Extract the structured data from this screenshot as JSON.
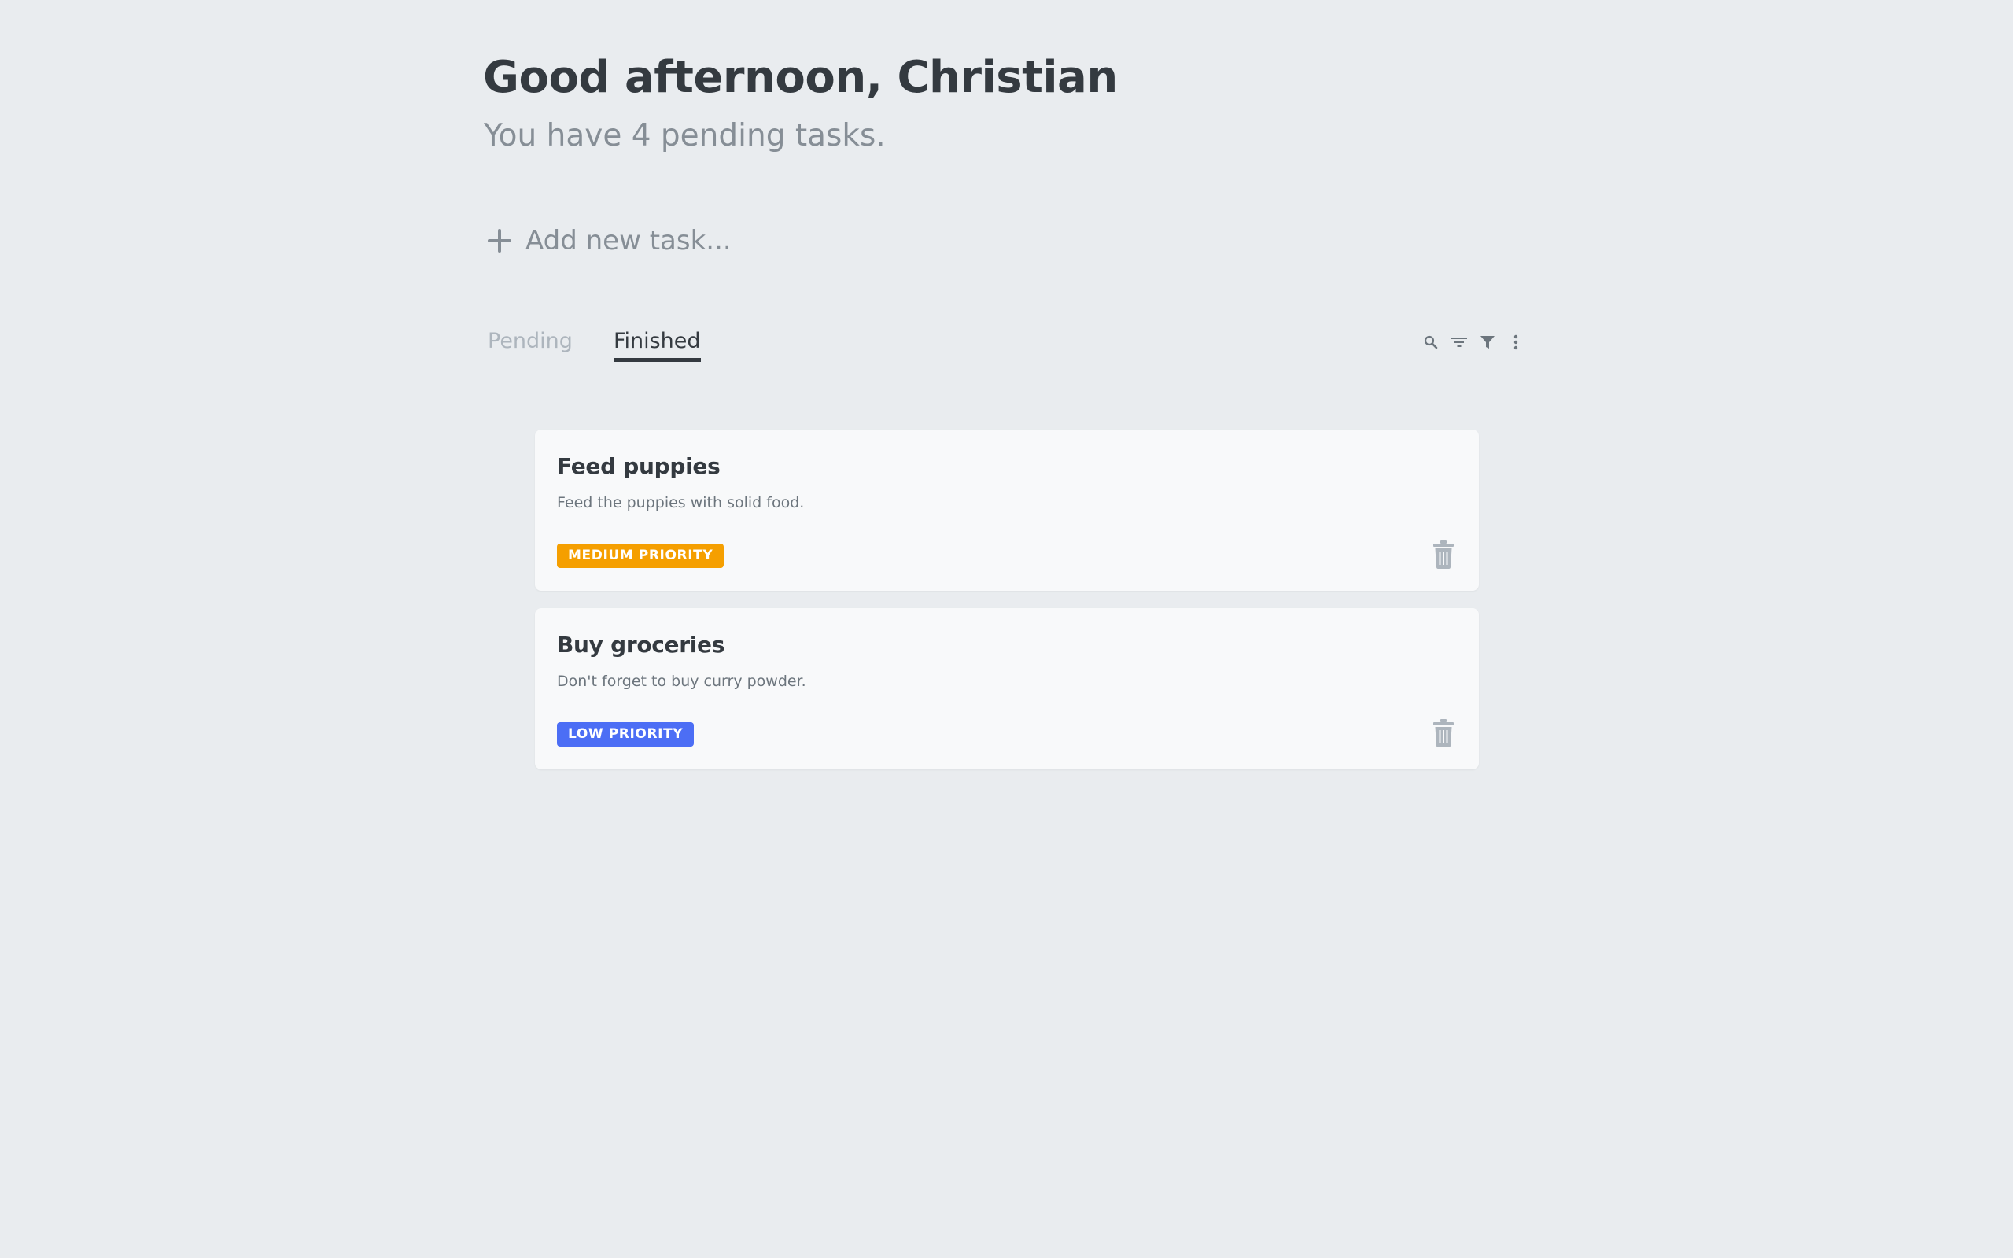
{
  "header": {
    "greeting": "Good afternoon, Christian",
    "subtitle": "You have 4 pending tasks."
  },
  "add_task": {
    "placeholder": "Add new task...",
    "icon": "plus-icon"
  },
  "tabs": [
    {
      "label": "Pending",
      "active": false
    },
    {
      "label": "Finished",
      "active": true
    }
  ],
  "toolbar": {
    "icons": [
      "search-icon",
      "sort-icon",
      "filter-icon",
      "more-vertical-icon"
    ]
  },
  "tasks": [
    {
      "title": "Feed puppies",
      "description": "Feed the puppies with solid food.",
      "priority": "MEDIUM PRIORITY",
      "priority_color": "#f59f00"
    },
    {
      "title": "Buy groceries",
      "description": "Don't forget to buy curry powder.",
      "priority": "LOW PRIORITY",
      "priority_color": "#4c6ef5"
    }
  ],
  "colors": {
    "background": "#e9ecef",
    "card": "#f8f9fa",
    "text_dark": "#343a40",
    "text_muted": "#868e96",
    "icon_gray": "#adb5bd"
  }
}
